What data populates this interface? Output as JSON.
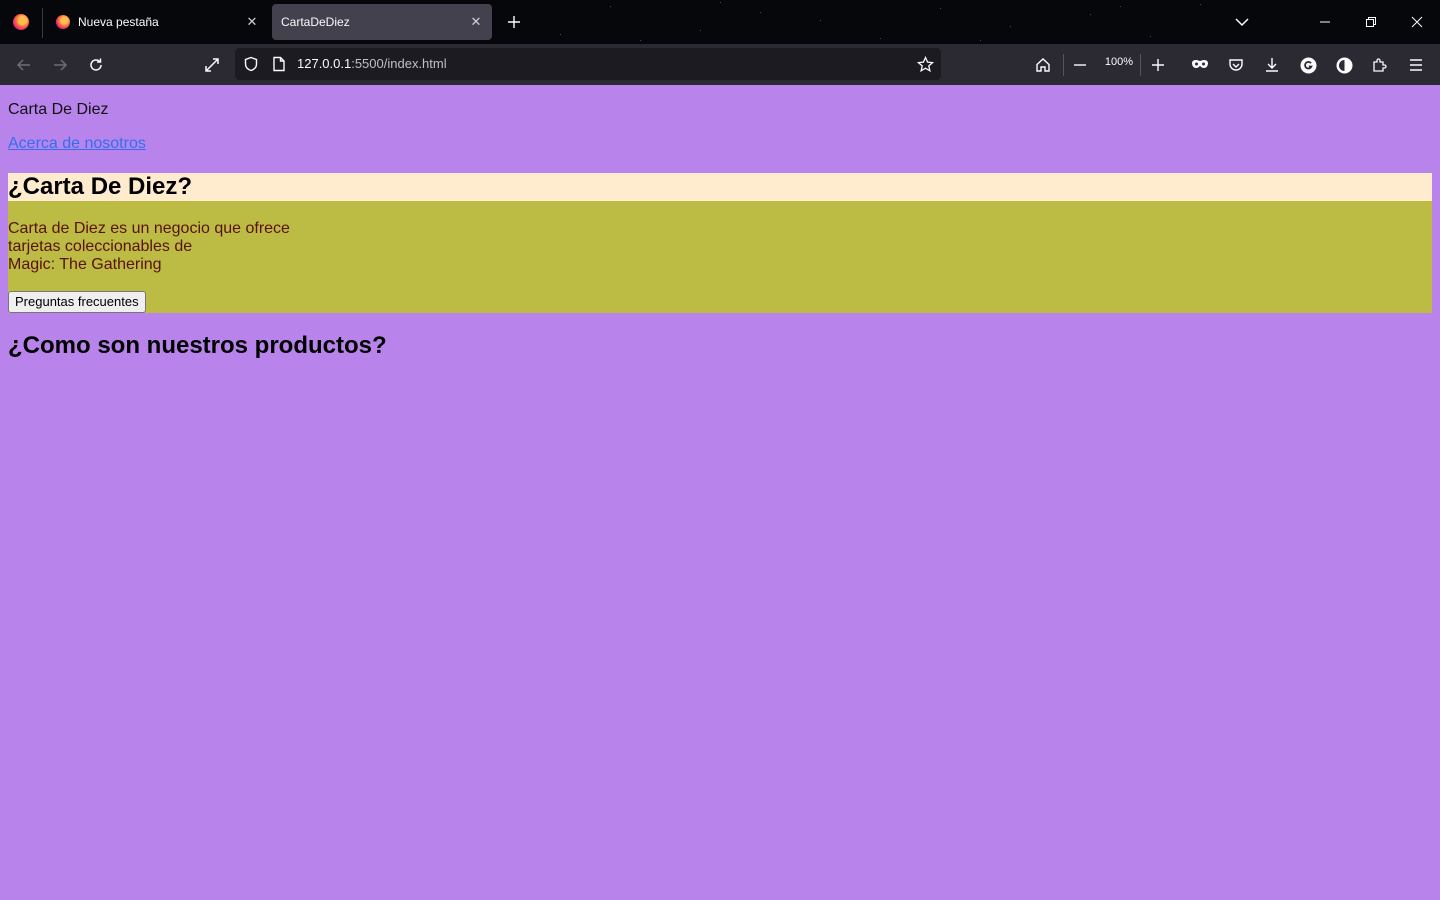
{
  "browser": {
    "tabs": [
      {
        "label": "Nueva pestaña",
        "active": false
      },
      {
        "label": "CartaDeDiez",
        "active": true
      }
    ],
    "address": {
      "host": "127.0.0.1",
      "rest": ":5500/index.html"
    },
    "zoom_label": "100%",
    "icons": {
      "firefox_menu": "firefox-logo-icon",
      "new_tab": "plus-icon",
      "tab_list": "chevron-down-icon",
      "back": "arrow-left-icon",
      "forward": "arrow-right-icon",
      "reload": "reload-icon",
      "fullscreen": "expand-icon",
      "tracking": "shield-icon",
      "page_info": "page-icon",
      "bookmark": "star-icon",
      "home": "home-icon",
      "zoom_out": "minus-icon",
      "zoom_in": "plus-icon",
      "private": "mask-icon",
      "pocket": "pocket-icon",
      "downloads": "download-icon",
      "grammarly": "grammarly-icon",
      "dark_reader": "dark-reader-icon",
      "extensions": "puzzle-icon",
      "menu": "hamburger-icon",
      "minimize": "minimize-icon",
      "restore": "restore-icon",
      "close_window": "close-icon"
    },
    "colors": {
      "tab_strip": "#06070b",
      "nav_bar": "#2b2a33",
      "url_field": "#1c1b22"
    }
  },
  "page": {
    "site_name": "Carta De Diez",
    "about_link": "Acerca de nosotros",
    "hero": {
      "title": "¿Carta De Diez?",
      "lines": [
        "Carta de Diez es un negocio que ofrece",
        "tarjetas coleccionables de",
        "Magic: The Gathering"
      ],
      "faq_button": "Preguntas frecuentes"
    },
    "products_title": "¿Como son nuestros productos?",
    "colors": {
      "background": "#b884ec",
      "hero_title_band": "#ffecce",
      "hero_body": "#bcbc45",
      "hero_text": "#5a1010",
      "link": "#2f6ff0"
    }
  }
}
